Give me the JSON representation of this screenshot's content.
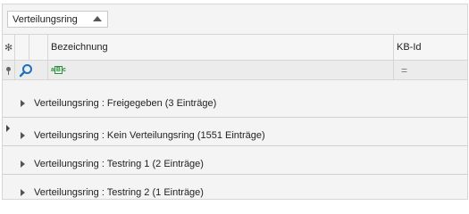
{
  "group_panel": {
    "chip_label": "Verteilungsring",
    "sort_icon": "sort-ascending-icon"
  },
  "header": {
    "new_row_symbol": "✻",
    "columns": [
      "Bezeichnung",
      "KB-Id"
    ]
  },
  "filter_row": {
    "search_icon": "search-icon",
    "bezeichnung_filter_icon": "text-filter-icon",
    "bezeichnung_filter_letters": [
      "a",
      "B",
      "c"
    ],
    "kbid_filter_icon": "equals-icon",
    "kbid_filter_symbol": "="
  },
  "groups": [
    {
      "text": "Verteilungsring : Freigegeben (3 Einträge)",
      "focused": false
    },
    {
      "text": "Verteilungsring : Kein Verteilungsring (1551 Einträge)",
      "focused": true
    },
    {
      "text": "Verteilungsring : Testring 1 (2 Einträge)",
      "focused": false
    },
    {
      "text": "Verteilungsring : Testring 2 (1 Einträge)",
      "focused": false
    }
  ],
  "colors": {
    "border": "#d6d6d6",
    "background": "#f4f4f4",
    "search_icon": "#1f6fbf",
    "abc_icon": "#2a8f3a"
  }
}
